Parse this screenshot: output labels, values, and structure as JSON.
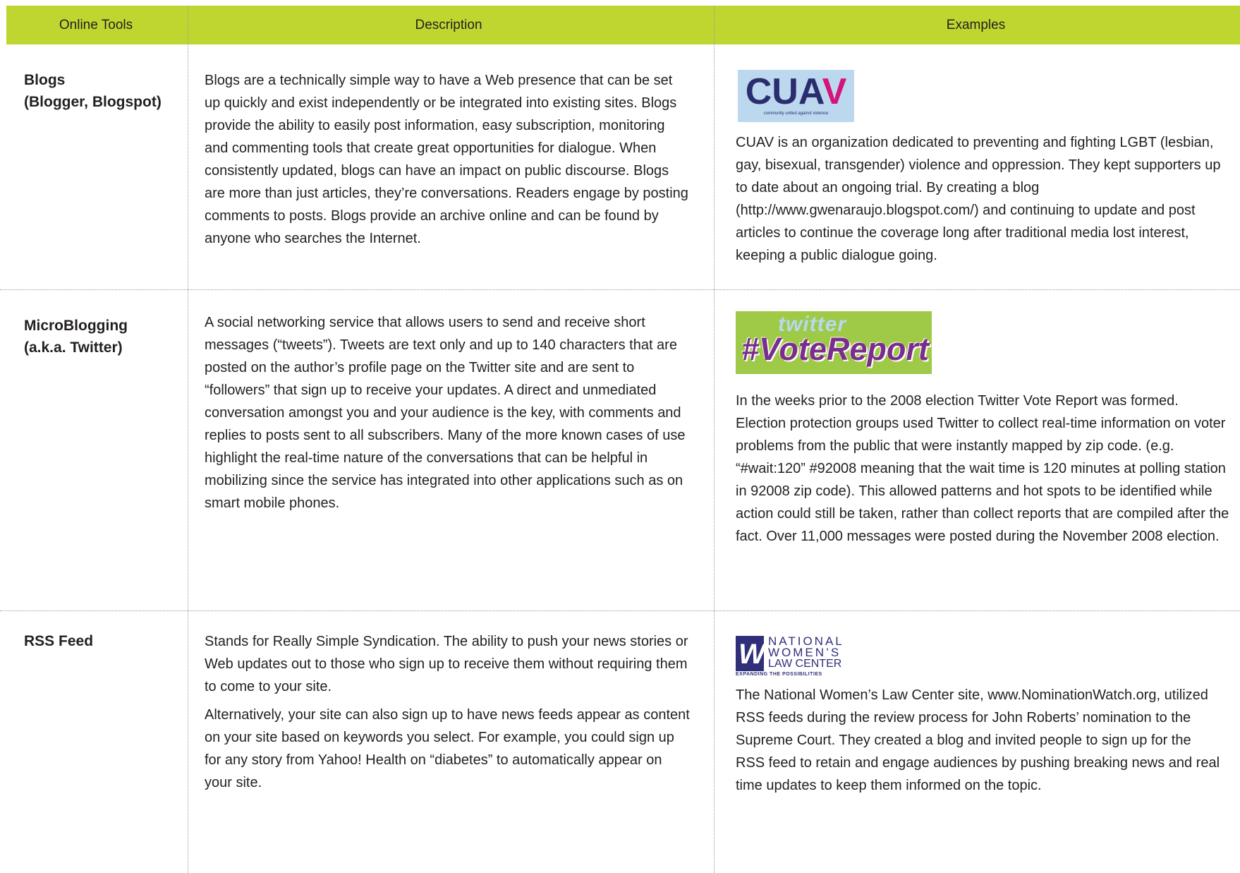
{
  "header": {
    "col1": "Online Tools",
    "col2": "Description",
    "col3": "Examples"
  },
  "colors": {
    "header_bg": "#bfd630",
    "text": "#231f20",
    "rule": "#9a9a9a"
  },
  "rows": [
    {
      "tool": "Blogs\n(Blogger, Blogspot)",
      "description": [
        "Blogs are a technically simple way to have a Web presence that can be set up quickly and exist independently or be integrated into existing sites. Blogs provide the ability to easily post information, easy subscription, monitoring and commenting tools that create great opportunities for dialogue. When consistently updated, blogs can have an impact on public discourse. Blogs are more than just articles, they’re conversations. Readers engage by posting comments to posts. Blogs provide an archive online and can be found by anyone who searches the Internet."
      ],
      "logo": {
        "text": "CUAV",
        "subtext": "community united against violence",
        "icon": "cuav-logo"
      },
      "example": "CUAV is an organization dedicated to preventing and fighting LGBT (lesbian, gay, bisexual, transgender) violence and oppression. They kept supporters up to date about an ongoing trial. By creating a blog (http://www.gwenaraujo.blogspot.com/) and continuing to update and post articles to continue the coverage long after traditional media lost interest, keeping a public dialogue going."
    },
    {
      "tool": "MicroBlogging\n(a.k.a. Twitter)",
      "description": [
        "A social networking service that allows users to send and receive short messages (“tweets”). Tweets are text only and up to 140 characters that are posted on the author’s profile page on the Twitter site and are sent to “followers” that sign up to receive your updates. A direct and unmediated conversation amongst you and your audience is the key, with comments and replies to posts sent to all subscribers. Many of the more known cases of use highlight the real-time nature of the conversations that can be helpful in mobilizing since the service has integrated into other applications such as on smart mobile phones."
      ],
      "logo": {
        "text": "#VoteReport",
        "subtext": "twitter",
        "icon": "twitter-vote-report-logo"
      },
      "example": "In the weeks prior to the 2008 election Twitter Vote Report was formed. Election protection groups used Twitter to collect real-time information on voter problems from the public that were instantly mapped by zip code. (e.g. “#wait:120” #92008 meaning that the wait time is 120 minutes at polling station in 92008 zip code). This allowed patterns and hot spots to be identified while action could still be taken, rather than collect reports that are compiled after the fact. Over 11,000 messages were posted during the November 2008 election."
    },
    {
      "tool": "RSS Feed",
      "description": [
        "Stands for Really Simple Syndication. The ability to push your news stories or Web updates out to those who sign up to receive them without requiring them to come to your site.",
        "Alternatively, your site can also sign up to have news feeds appear as content on your site based on keywords you select. For example, you could sign up for any story from Yahoo! Health on “diabetes” to automatically appear on your site."
      ],
      "logo": {
        "line1": "NATIONAL",
        "line2": "WOMEN’S",
        "line3": "LAW CENTER",
        "tagline": "EXPANDING THE POSSIBILITIES",
        "icon": "nwlc-logo"
      },
      "example": "The National Women’s Law Center site, www.NominationWatch.org, utilized RSS feeds during the review process for John Roberts’ nomination to the Supreme Court. They created a blog and invited people to sign up for the RSS feed to retain and engage audiences by pushing breaking news and real time updates to keep them informed on the topic."
    }
  ]
}
